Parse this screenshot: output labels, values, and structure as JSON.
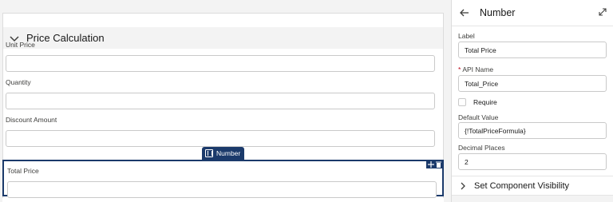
{
  "canvas": {
    "section_title": "Price Calculation",
    "fields": [
      {
        "label": "Unit Price"
      },
      {
        "label": "Quantity"
      },
      {
        "label": "Discount Amount"
      },
      {
        "label": "Total Price"
      }
    ],
    "selected_tag": "Number"
  },
  "panel": {
    "title": "Number",
    "label_caption": "Label",
    "label_value": "Total Price",
    "api_required_marker": "*",
    "api_caption": "API Name",
    "api_value": "Total_Price",
    "require_label": "Require",
    "default_caption": "Default Value",
    "default_value": "{!TotalPriceFormula}",
    "decimal_caption": "Decimal Places",
    "decimal_value": "2",
    "visibility_title": "Set Component Visibility"
  },
  "colors": {
    "selection": "#1b3a6b",
    "required": "#ba0517",
    "border": "#c9c9c9"
  },
  "icons": [
    "chevron-down-icon",
    "number-icon",
    "move-icon",
    "delete-icon",
    "back-arrow-icon",
    "expand-icon",
    "chevron-right-icon"
  ]
}
